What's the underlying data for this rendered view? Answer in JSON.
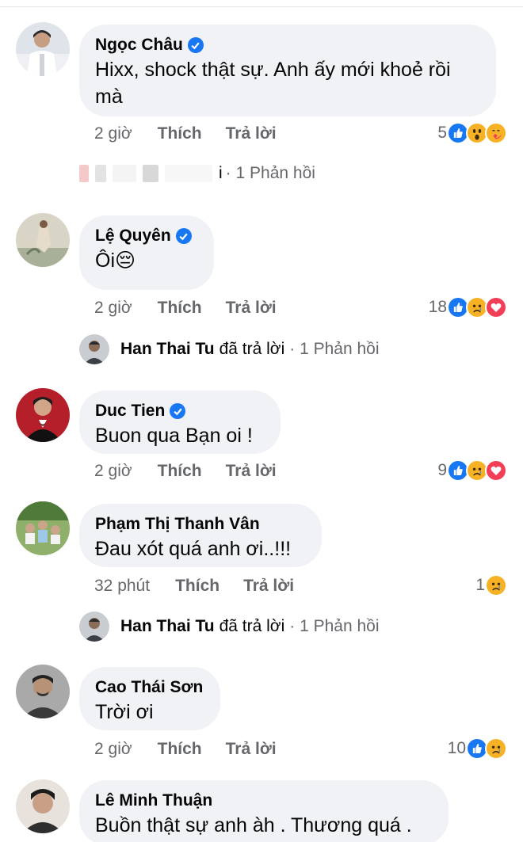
{
  "colors": {
    "bubble": "#f0f2f5",
    "meta": "#65676b",
    "verified": "#1877f2",
    "like": "#1877f2",
    "love": "#f33e58",
    "haha": "#f7b125"
  },
  "comments": [
    {
      "name": "Ngọc Châu",
      "verified": true,
      "text_line1": "Hixx, shock thật sự. Anh ấy mới khoẻ rồi",
      "text_line2": "mà",
      "time": "2 giờ",
      "like": "Thích",
      "reply": "Trả lời",
      "react_count": "5",
      "reactions": [
        "like-icon",
        "wow-icon",
        "care-icon"
      ]
    },
    {
      "name": "Lệ Quyên",
      "verified": true,
      "text": "Ôi😔",
      "time": "2 giờ",
      "like": "Thích",
      "reply": "Trả lời",
      "react_count": "18",
      "reactions": [
        "like-icon",
        "sad-icon",
        "love-icon"
      ]
    },
    {
      "name": "Duc Tien",
      "verified": true,
      "text": "Buon qua Bạn oi !",
      "time": "2 giờ",
      "like": "Thích",
      "reply": "Trả lời",
      "react_count": "9",
      "reactions": [
        "like-icon",
        "sad-icon",
        "love-icon"
      ]
    },
    {
      "name": "Phạm Thị Thanh Vân",
      "verified": false,
      "text": "Đau xót quá anh ơi..!!!",
      "time": "32 phút",
      "like": "Thích",
      "reply": "Trả lời",
      "react_count": "1",
      "reactions": [
        "sad-icon"
      ]
    },
    {
      "name": "Cao Thái Sơn",
      "verified": false,
      "text": "Trời ơi",
      "time": "2 giờ",
      "like": "Thích",
      "reply": "Trả lời",
      "react_count": "10",
      "reactions": [
        "like-icon",
        "sad-icon"
      ]
    },
    {
      "name": "Lê Minh Thuận",
      "verified": false,
      "text": "Buồn thật sự anh àh . Thương quá ."
    }
  ],
  "reply_rows": [
    {
      "suffix": "i",
      "count_text": "· 1 Phản hồi"
    },
    {
      "name": "Han Thai Tu",
      "verb": "đã trả lời",
      "count_text": "· 1 Phản hồi"
    },
    {
      "name": "Han Thai Tu",
      "verb": "đã trả lời",
      "count_text": "· 1 Phản hồi"
    }
  ]
}
